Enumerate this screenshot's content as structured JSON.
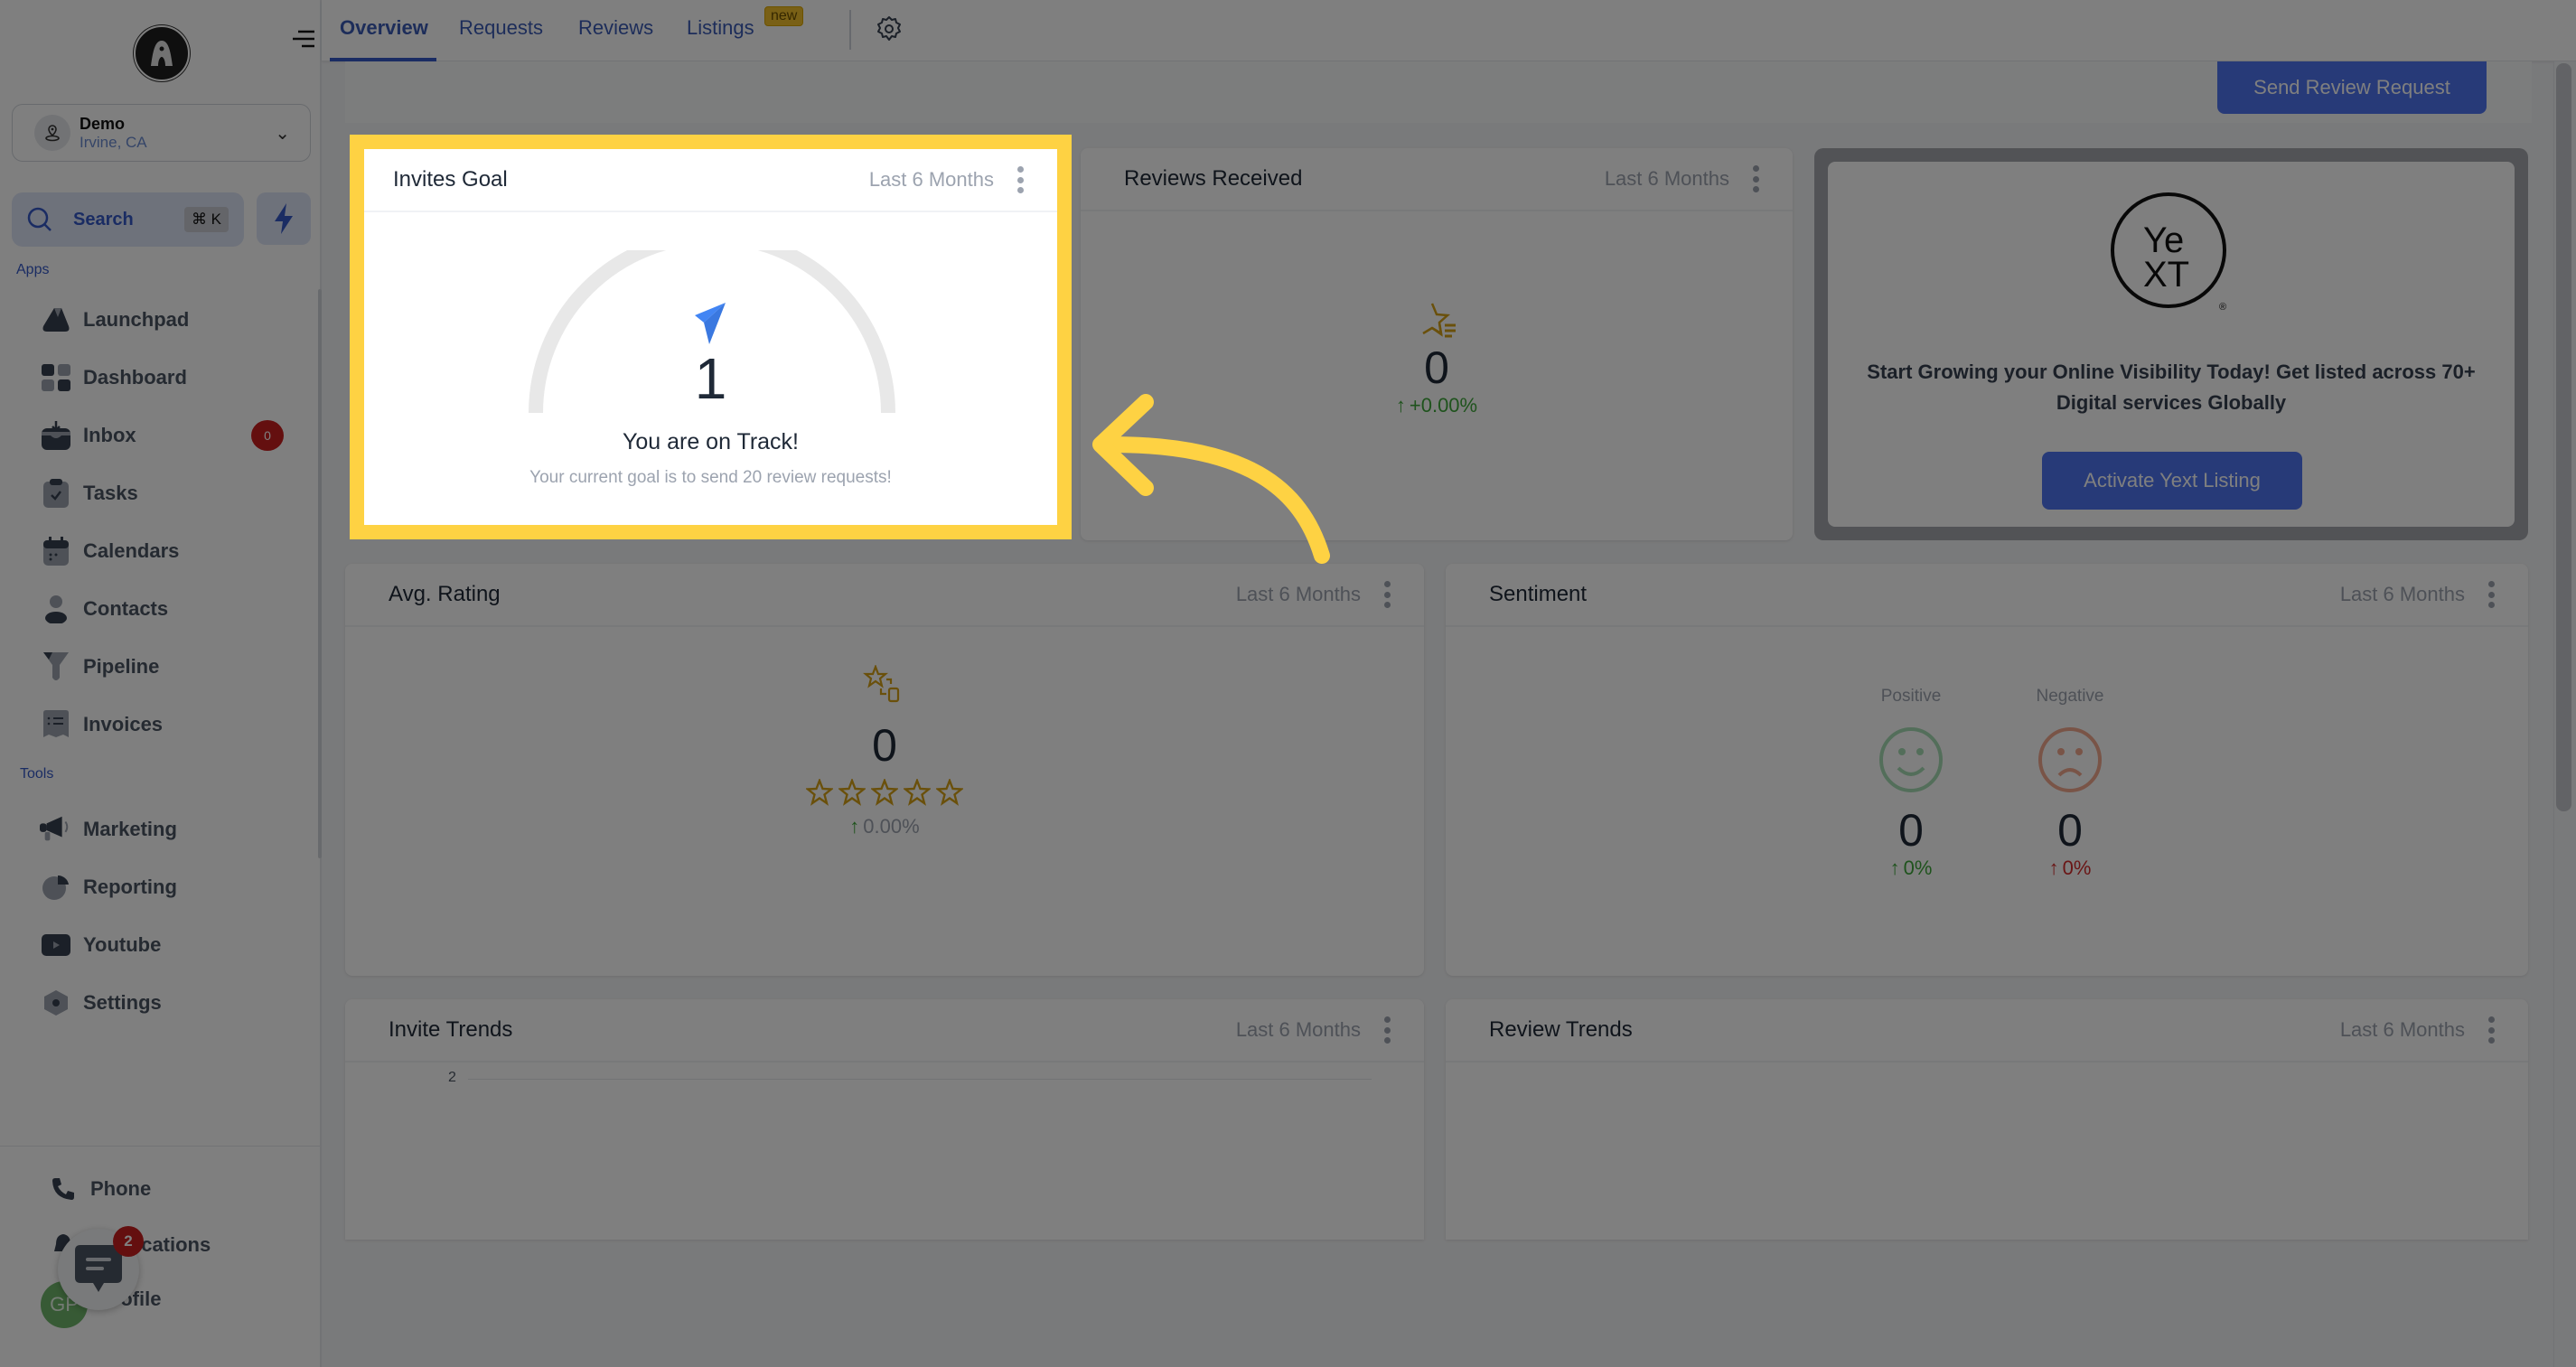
{
  "sidebar": {
    "location": {
      "name": "Demo",
      "city": "Irvine, CA"
    },
    "search": {
      "label": "Search",
      "shortcut": "⌘ K"
    },
    "apps_label": "Apps",
    "apps": [
      {
        "label": "Launchpad",
        "icon": "rocket-icon"
      },
      {
        "label": "Dashboard",
        "icon": "dashboard-icon"
      },
      {
        "label": "Inbox",
        "icon": "inbox-icon",
        "badge": "0"
      },
      {
        "label": "Tasks",
        "icon": "tasks-icon"
      },
      {
        "label": "Calendars",
        "icon": "calendar-icon"
      },
      {
        "label": "Contacts",
        "icon": "contacts-icon"
      },
      {
        "label": "Pipeline",
        "icon": "pipeline-icon"
      },
      {
        "label": "Invoices",
        "icon": "invoices-icon"
      }
    ],
    "tools_label": "Tools",
    "tools": [
      {
        "label": "Marketing",
        "icon": "megaphone-icon"
      },
      {
        "label": "Reporting",
        "icon": "pie-chart-icon"
      },
      {
        "label": "Youtube",
        "icon": "youtube-icon"
      },
      {
        "label": "Settings",
        "icon": "settings-icon"
      }
    ],
    "bottom": [
      {
        "label": "Phone",
        "icon": "phone-icon"
      },
      {
        "label": "Notifications",
        "icon": "bell-icon"
      },
      {
        "label": "Profile",
        "icon": "avatar"
      }
    ],
    "profile_initials": "GP",
    "chat_badge": "2"
  },
  "topbar": {
    "tabs": [
      {
        "label": "Overview",
        "active": true
      },
      {
        "label": "Requests"
      },
      {
        "label": "Reviews"
      },
      {
        "label": "Listings",
        "badge": "new"
      }
    ]
  },
  "main": {
    "send_review_request": "Send Review Request",
    "range_label": "Last 6 Months",
    "invites_goal": {
      "title": "Invites Goal",
      "value": "1",
      "status": "You are on Track!",
      "subtext": "Your current goal is to send 20 review requests!",
      "goal": 20,
      "progress_fraction": 0.05
    },
    "reviews_received": {
      "title": "Reviews Received",
      "value": "0",
      "delta": "+0.00%"
    },
    "yext": {
      "text": "Start Growing your Online Visibility Today! Get listed across 70+ Digital services Globally",
      "button": "Activate Yext Listing"
    },
    "avg_rating": {
      "title": "Avg. Rating",
      "value": "0",
      "stars_filled": 0,
      "stars_total": 5,
      "delta": "0.00%"
    },
    "sentiment": {
      "title": "Sentiment",
      "positive": {
        "label": "Positive",
        "value": "0",
        "delta": "0%"
      },
      "negative": {
        "label": "Negative",
        "value": "0",
        "delta": "0%"
      }
    },
    "invite_trends": {
      "title": "Invite Trends",
      "y_tick": "2"
    },
    "review_trends": {
      "title": "Review Trends"
    }
  },
  "colors": {
    "accent": "#3559c7",
    "button": "#4f75f0",
    "highlight": "#fed243",
    "positive": "#3fa63b",
    "negative": "#d42c2c",
    "star": "#d4a017"
  }
}
